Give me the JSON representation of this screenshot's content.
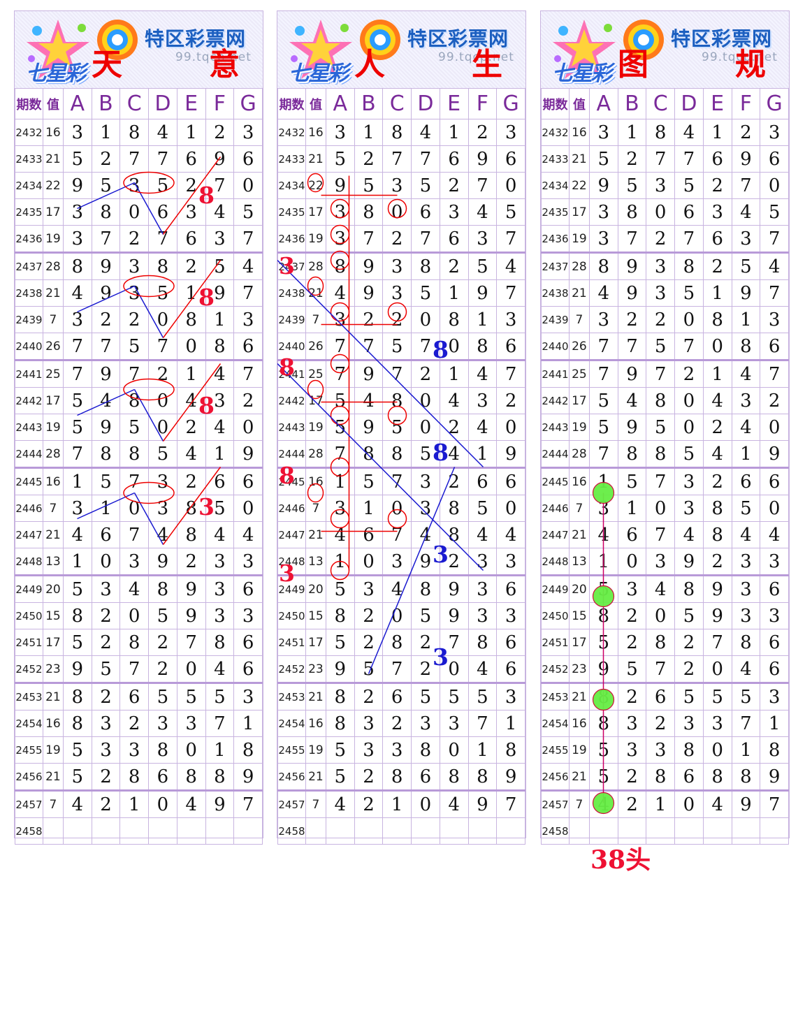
{
  "site": {
    "brand": "特区彩票网",
    "url": "99.tqcp.net",
    "game": "七星彩"
  },
  "panels": [
    {
      "left": "天",
      "right": "意"
    },
    {
      "left": "人",
      "right": "生"
    },
    {
      "left": "图",
      "right": "规"
    }
  ],
  "header": {
    "period": "期数",
    "sum": "值",
    "cols": [
      "A",
      "B",
      "C",
      "D",
      "E",
      "F",
      "G"
    ]
  },
  "rows": [
    {
      "p": "2432",
      "s": "16",
      "d": [
        "3",
        "1",
        "8",
        "4",
        "1",
        "2",
        "3"
      ]
    },
    {
      "p": "2433",
      "s": "21",
      "d": [
        "5",
        "2",
        "7",
        "7",
        "6",
        "9",
        "6"
      ]
    },
    {
      "p": "2434",
      "s": "22",
      "d": [
        "9",
        "5",
        "3",
        "5",
        "2",
        "7",
        "0"
      ]
    },
    {
      "p": "2435",
      "s": "17",
      "d": [
        "3",
        "8",
        "0",
        "6",
        "3",
        "4",
        "5"
      ]
    },
    {
      "p": "2436",
      "s": "19",
      "d": [
        "3",
        "7",
        "2",
        "7",
        "6",
        "3",
        "7"
      ]
    },
    {
      "p": "2437",
      "s": "28",
      "d": [
        "8",
        "9",
        "3",
        "8",
        "2",
        "5",
        "4"
      ]
    },
    {
      "p": "2438",
      "s": "21",
      "d": [
        "4",
        "9",
        "3",
        "5",
        "1",
        "9",
        "7"
      ]
    },
    {
      "p": "2439",
      "s": "7",
      "d": [
        "3",
        "2",
        "2",
        "0",
        "8",
        "1",
        "3"
      ]
    },
    {
      "p": "2440",
      "s": "26",
      "d": [
        "7",
        "7",
        "5",
        "7",
        "0",
        "8",
        "6"
      ]
    },
    {
      "p": "2441",
      "s": "25",
      "d": [
        "7",
        "9",
        "7",
        "2",
        "1",
        "4",
        "7"
      ]
    },
    {
      "p": "2442",
      "s": "17",
      "d": [
        "5",
        "4",
        "8",
        "0",
        "4",
        "3",
        "2"
      ]
    },
    {
      "p": "2443",
      "s": "19",
      "d": [
        "5",
        "9",
        "5",
        "0",
        "2",
        "4",
        "0"
      ]
    },
    {
      "p": "2444",
      "s": "28",
      "d": [
        "7",
        "8",
        "8",
        "5",
        "4",
        "1",
        "9"
      ]
    },
    {
      "p": "2445",
      "s": "16",
      "d": [
        "1",
        "5",
        "7",
        "3",
        "2",
        "6",
        "6"
      ]
    },
    {
      "p": "2446",
      "s": "7",
      "d": [
        "3",
        "1",
        "0",
        "3",
        "8",
        "5",
        "0"
      ]
    },
    {
      "p": "2447",
      "s": "21",
      "d": [
        "4",
        "6",
        "7",
        "4",
        "8",
        "4",
        "4"
      ]
    },
    {
      "p": "2448",
      "s": "13",
      "d": [
        "1",
        "0",
        "3",
        "9",
        "2",
        "3",
        "3"
      ]
    },
    {
      "p": "2449",
      "s": "20",
      "d": [
        "5",
        "3",
        "4",
        "8",
        "9",
        "3",
        "6"
      ]
    },
    {
      "p": "2450",
      "s": "15",
      "d": [
        "8",
        "2",
        "0",
        "5",
        "9",
        "3",
        "3"
      ]
    },
    {
      "p": "2451",
      "s": "17",
      "d": [
        "5",
        "2",
        "8",
        "2",
        "7",
        "8",
        "6"
      ]
    },
    {
      "p": "2452",
      "s": "23",
      "d": [
        "9",
        "5",
        "7",
        "2",
        "0",
        "4",
        "6"
      ]
    },
    {
      "p": "2453",
      "s": "21",
      "d": [
        "8",
        "2",
        "6",
        "5",
        "5",
        "5",
        "3"
      ]
    },
    {
      "p": "2454",
      "s": "16",
      "d": [
        "8",
        "3",
        "2",
        "3",
        "3",
        "7",
        "1"
      ]
    },
    {
      "p": "2455",
      "s": "19",
      "d": [
        "5",
        "3",
        "3",
        "8",
        "0",
        "1",
        "8"
      ]
    },
    {
      "p": "2456",
      "s": "21",
      "d": [
        "5",
        "2",
        "8",
        "6",
        "8",
        "8",
        "9"
      ]
    },
    {
      "p": "2457",
      "s": "7",
      "d": [
        "4",
        "2",
        "1",
        "0",
        "4",
        "9",
        "7"
      ]
    },
    {
      "p": "2458",
      "s": "",
      "d": [
        "",
        "",
        "",
        "",
        "",
        "",
        ""
      ]
    }
  ],
  "annotations": {
    "p1": [
      "8",
      "8",
      "8",
      "3"
    ],
    "p2_red": [
      "3",
      "8",
      "8",
      "3"
    ],
    "p2_blue": [
      "8",
      "8",
      "3",
      "3"
    ]
  },
  "footer": "38头",
  "colors": {
    "red": "#ee0000",
    "blue": "#1a1ad0",
    "grid": "#c8b4e0",
    "header": "#7a2a9a",
    "green": "#66ee44"
  }
}
